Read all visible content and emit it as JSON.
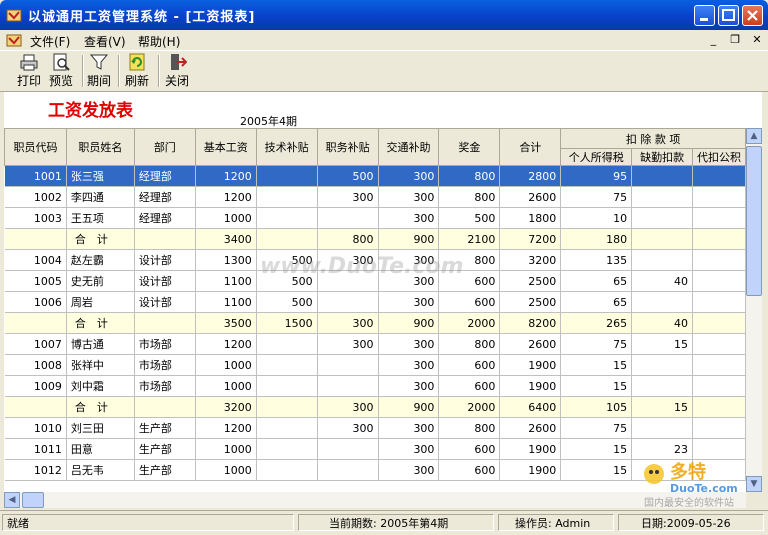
{
  "window": {
    "title": "以诚通用工资管理系统 - [工资报表]"
  },
  "menu": {
    "items": [
      "文件(F)",
      "查看(V)",
      "帮助(H)"
    ]
  },
  "toolbar": {
    "print": "打印",
    "preview": "预览",
    "period": "期间",
    "refresh": "刷新",
    "close": "关闭"
  },
  "report": {
    "title": "工资发放表",
    "period": "2005年4期"
  },
  "table": {
    "headers": [
      "职员代码",
      "职员姓名",
      "部门",
      "基本工资",
      "技术补贴",
      "职务补贴",
      "交通补助",
      "奖金",
      "合计"
    ],
    "deduction_group": "扣 除 款 项",
    "deduction_headers": [
      "个人所得税",
      "缺勤扣款",
      "代扣公积"
    ],
    "rows": [
      {
        "code": "1001",
        "name": "张三强",
        "dept": "经理部",
        "base": "1200",
        "tech": "",
        "duty": "500",
        "traffic": "300",
        "bonus": "800",
        "total": "2800",
        "tax": "95",
        "absent": "",
        "fund": "",
        "type": "selected"
      },
      {
        "code": "1002",
        "name": "李四通",
        "dept": "经理部",
        "base": "1200",
        "tech": "",
        "duty": "300",
        "traffic": "300",
        "bonus": "800",
        "total": "2600",
        "tax": "75",
        "absent": "",
        "fund": "",
        "type": "normal"
      },
      {
        "code": "1003",
        "name": "王五项",
        "dept": "经理部",
        "base": "1000",
        "tech": "",
        "duty": "",
        "traffic": "300",
        "bonus": "500",
        "total": "1800",
        "tax": "10",
        "absent": "",
        "fund": "",
        "type": "normal"
      },
      {
        "code": "",
        "name": "合　计",
        "dept": "",
        "base": "3400",
        "tech": "",
        "duty": "800",
        "traffic": "900",
        "bonus": "2100",
        "total": "7200",
        "tax": "180",
        "absent": "",
        "fund": "",
        "type": "subtotal"
      },
      {
        "code": "1004",
        "name": "赵左霸",
        "dept": "设计部",
        "base": "1300",
        "tech": "500",
        "duty": "300",
        "traffic": "300",
        "bonus": "800",
        "total": "3200",
        "tax": "135",
        "absent": "",
        "fund": "",
        "type": "normal"
      },
      {
        "code": "1005",
        "name": "史无前",
        "dept": "设计部",
        "base": "1100",
        "tech": "500",
        "duty": "",
        "traffic": "300",
        "bonus": "600",
        "total": "2500",
        "tax": "65",
        "absent": "40",
        "fund": "",
        "type": "normal"
      },
      {
        "code": "1006",
        "name": "周岩",
        "dept": "设计部",
        "base": "1100",
        "tech": "500",
        "duty": "",
        "traffic": "300",
        "bonus": "600",
        "total": "2500",
        "tax": "65",
        "absent": "",
        "fund": "",
        "type": "normal"
      },
      {
        "code": "",
        "name": "合　计",
        "dept": "",
        "base": "3500",
        "tech": "1500",
        "duty": "300",
        "traffic": "900",
        "bonus": "2000",
        "total": "8200",
        "tax": "265",
        "absent": "40",
        "fund": "",
        "type": "subtotal"
      },
      {
        "code": "1007",
        "name": "博古通",
        "dept": "市场部",
        "base": "1200",
        "tech": "",
        "duty": "300",
        "traffic": "300",
        "bonus": "800",
        "total": "2600",
        "tax": "75",
        "absent": "15",
        "fund": "",
        "type": "normal"
      },
      {
        "code": "1008",
        "name": "张祥中",
        "dept": "市场部",
        "base": "1000",
        "tech": "",
        "duty": "",
        "traffic": "300",
        "bonus": "600",
        "total": "1900",
        "tax": "15",
        "absent": "",
        "fund": "",
        "type": "normal"
      },
      {
        "code": "1009",
        "name": "刘中霜",
        "dept": "市场部",
        "base": "1000",
        "tech": "",
        "duty": "",
        "traffic": "300",
        "bonus": "600",
        "total": "1900",
        "tax": "15",
        "absent": "",
        "fund": "",
        "type": "normal"
      },
      {
        "code": "",
        "name": "合　计",
        "dept": "",
        "base": "3200",
        "tech": "",
        "duty": "300",
        "traffic": "900",
        "bonus": "2000",
        "total": "6400",
        "tax": "105",
        "absent": "15",
        "fund": "",
        "type": "subtotal"
      },
      {
        "code": "1010",
        "name": "刘三田",
        "dept": "生产部",
        "base": "1200",
        "tech": "",
        "duty": "300",
        "traffic": "300",
        "bonus": "800",
        "total": "2600",
        "tax": "75",
        "absent": "",
        "fund": "",
        "type": "normal"
      },
      {
        "code": "1011",
        "name": "田意",
        "dept": "生产部",
        "base": "1000",
        "tech": "",
        "duty": "",
        "traffic": "300",
        "bonus": "600",
        "total": "1900",
        "tax": "15",
        "absent": "23",
        "fund": "",
        "type": "normal"
      },
      {
        "code": "1012",
        "name": "吕无韦",
        "dept": "生产部",
        "base": "1000",
        "tech": "",
        "duty": "",
        "traffic": "300",
        "bonus": "600",
        "total": "1900",
        "tax": "15",
        "absent": "",
        "fund": "",
        "type": "normal"
      }
    ]
  },
  "status": {
    "ready": "就绪",
    "current_period": "当前期数: 2005年第4期",
    "operator": "操作员: Admin",
    "date": "日期:2009-05-26"
  },
  "watermark": {
    "text": "www.DuoTe.com"
  },
  "logo": {
    "cn": "多特",
    "en": "DuoTe.com",
    "slogan": "国内最安全的软件站"
  },
  "colors": {
    "title_red": "#e00000",
    "selection": "#316ac5",
    "subtotal_bg": "#ffffe0"
  }
}
